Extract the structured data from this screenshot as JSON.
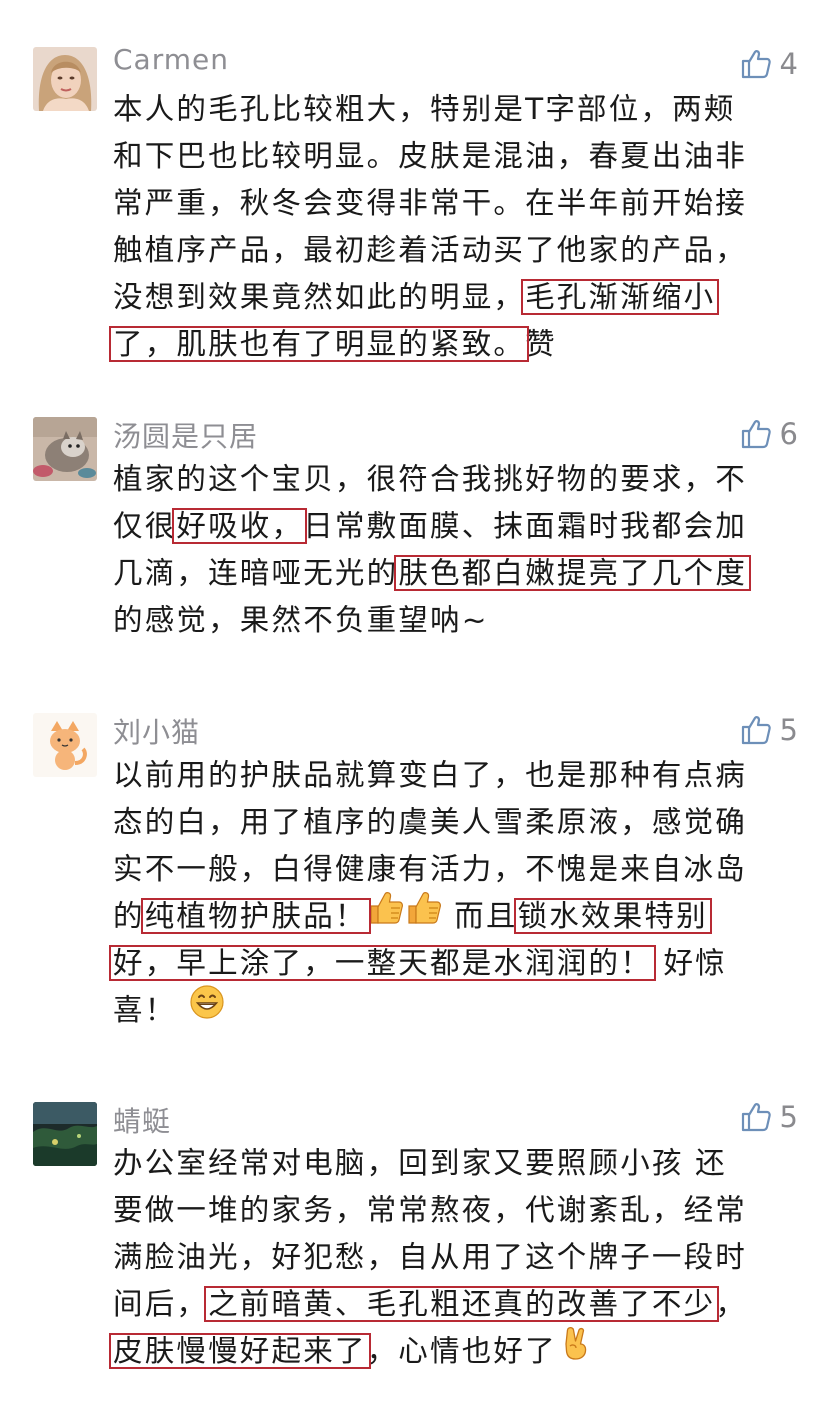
{
  "comments": [
    {
      "author": "Carmen",
      "likes": "4",
      "avatar": "woman-photo-avatar",
      "lines": [
        [
          {
            "t": "本人的毛孔比较粗大，特别是T字部位，两颊"
          }
        ],
        [
          {
            "t": "和下巴也比较明显。皮肤是混油，春夏出油非"
          }
        ],
        [
          {
            "t": "常严重，秋冬会变得非常干。在半年前开始接"
          }
        ],
        [
          {
            "t": "触植序产品，最初趁着活动买了他家的产品，"
          }
        ],
        [
          {
            "t": "没想到效果竟然如此的明显，"
          },
          {
            "t": "毛孔渐渐缩小",
            "hl": true
          }
        ],
        [
          {
            "t": "了，肌肤也有了明显的紧致。",
            "hl": true
          },
          {
            "t": "赞"
          }
        ]
      ]
    },
    {
      "author": "汤圆是只居",
      "likes": "6",
      "avatar": "cat-photo-avatar",
      "lines": [
        [
          {
            "t": "植家的这个宝贝，很符合我挑好物的要求，不"
          }
        ],
        [
          {
            "t": "仅很"
          },
          {
            "t": "好吸收，",
            "hl": true
          },
          {
            "t": "日常敷面膜、抹面霜时我都会加"
          }
        ],
        [
          {
            "t": "几滴，连暗哑无光的"
          },
          {
            "t": "肤色都白嫩提亮了几个度",
            "hl": true
          }
        ],
        [
          {
            "t": "的感觉，果然不负重望呐~"
          }
        ]
      ]
    },
    {
      "author": "刘小猫",
      "likes": "5",
      "avatar": "cartoon-cat-avatar",
      "lines": [
        [
          {
            "t": "以前用的护肤品就算变白了，也是那种有点病"
          }
        ],
        [
          {
            "t": "态的白，用了植序的虞美人雪柔原液，感觉确"
          }
        ],
        [
          {
            "t": "实不一般，白得健康有活力，不愧是来自冰岛"
          }
        ],
        [
          {
            "t": "的"
          },
          {
            "t": "纯植物护肤品！",
            "hl": true
          },
          {
            "emoji": "thumbs-up"
          },
          {
            "emoji": "thumbs-up"
          },
          {
            "t": " 而且"
          },
          {
            "t": "锁水效果特别",
            "hl": true
          }
        ],
        [
          {
            "t": "好，早上涂了，一整天都是水润润的！",
            "hl": true
          },
          {
            "t": " 好惊"
          }
        ],
        [
          {
            "t": "喜！ "
          },
          {
            "emoji": "grinning-face"
          }
        ]
      ]
    },
    {
      "author": "蜻蜓",
      "likes": "5",
      "avatar": "landscape-photo-avatar",
      "lines": [
        [
          {
            "t": "办公室经常对电脑，回到家又要照顾小孩 还"
          }
        ],
        [
          {
            "t": "要做一堆的家务，常常熬夜，代谢紊乱，经常"
          }
        ],
        [
          {
            "t": "满脸油光，好犯愁，自从用了这个牌子一段时"
          }
        ],
        [
          {
            "t": "间后，"
          },
          {
            "t": "之前暗黄、毛孔粗还真的改善了不少",
            "hl": true
          },
          {
            "t": "，"
          }
        ],
        [
          {
            "t": "皮肤慢慢好起来了",
            "hl": true
          },
          {
            "t": "，心情也好了"
          },
          {
            "emoji": "victory-hand"
          }
        ]
      ]
    }
  ],
  "colors": {
    "highlight_border": "#b82a34",
    "name_gray": "#8e8e93",
    "text": "#1a1a1a"
  }
}
